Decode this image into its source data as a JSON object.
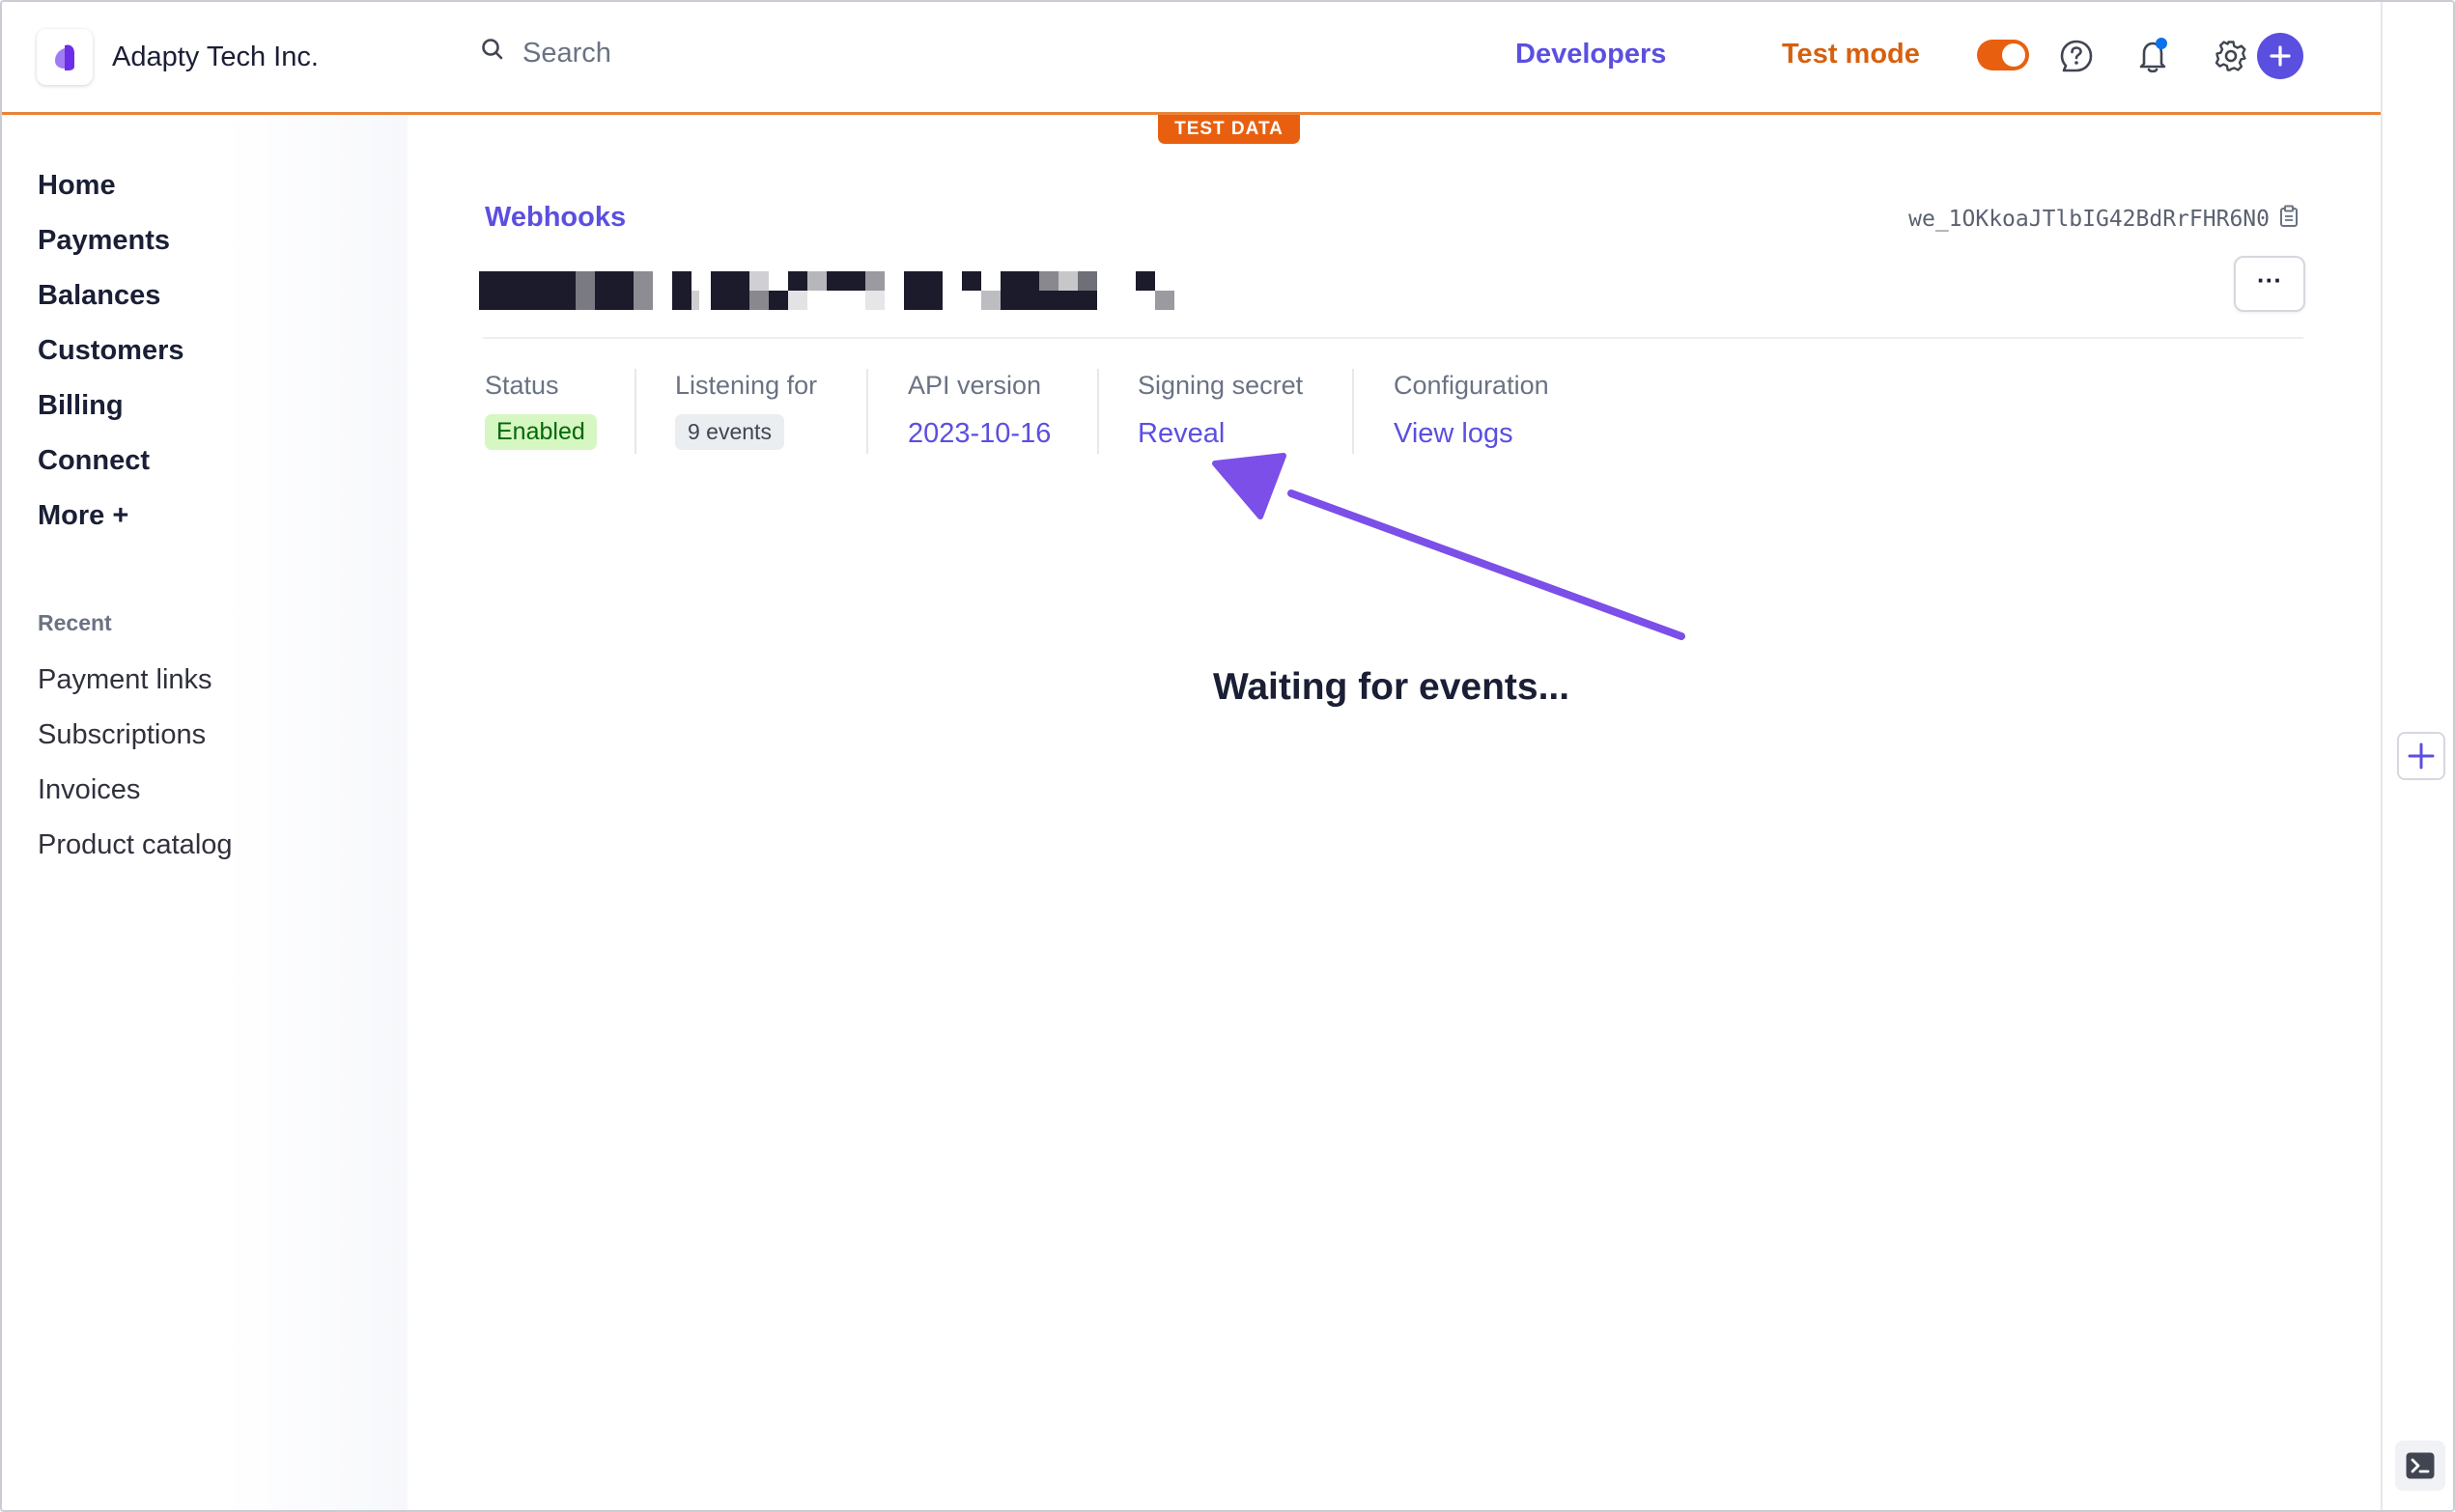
{
  "header": {
    "company_name": "Adapty Tech Inc.",
    "search_placeholder": "Search",
    "developers_label": "Developers",
    "test_mode_label": "Test mode",
    "test_mode_on": true,
    "test_data_badge": "TEST DATA"
  },
  "sidebar": {
    "nav": [
      {
        "label": "Home"
      },
      {
        "label": "Payments"
      },
      {
        "label": "Balances"
      },
      {
        "label": "Customers"
      },
      {
        "label": "Billing"
      },
      {
        "label": "Connect"
      },
      {
        "label": "More +"
      }
    ],
    "recent_title": "Recent",
    "recent": [
      {
        "label": "Payment links"
      },
      {
        "label": "Subscriptions"
      },
      {
        "label": "Invoices"
      },
      {
        "label": "Product catalog"
      }
    ]
  },
  "main": {
    "breadcrumb": "Webhooks",
    "endpoint_id": "we_1OKkoaJTlbIG42BdRrFHR6N0",
    "more_button": "···",
    "stats": {
      "status_label": "Status",
      "status_value": "Enabled",
      "listening_label": "Listening for",
      "listening_value": "9 events",
      "api_label": "API version",
      "api_value": "2023-10-16",
      "secret_label": "Signing secret",
      "secret_value": "Reveal",
      "config_label": "Configuration",
      "config_value": "View logs"
    },
    "waiting_text": "Waiting for events..."
  },
  "colors": {
    "accent": "#5b4fe0",
    "test_mode": "#e8600f",
    "annotation_arrow": "#7b4fe8",
    "enabled_bg": "#d7f7c2",
    "enabled_text": "#006908"
  },
  "icons": {
    "search": "search-icon",
    "help": "help-icon",
    "notifications": "bell-icon",
    "settings": "gear-icon",
    "create": "plus-icon",
    "copy": "clipboard-icon",
    "rail_add": "plus-icon",
    "terminal": "terminal-icon"
  }
}
